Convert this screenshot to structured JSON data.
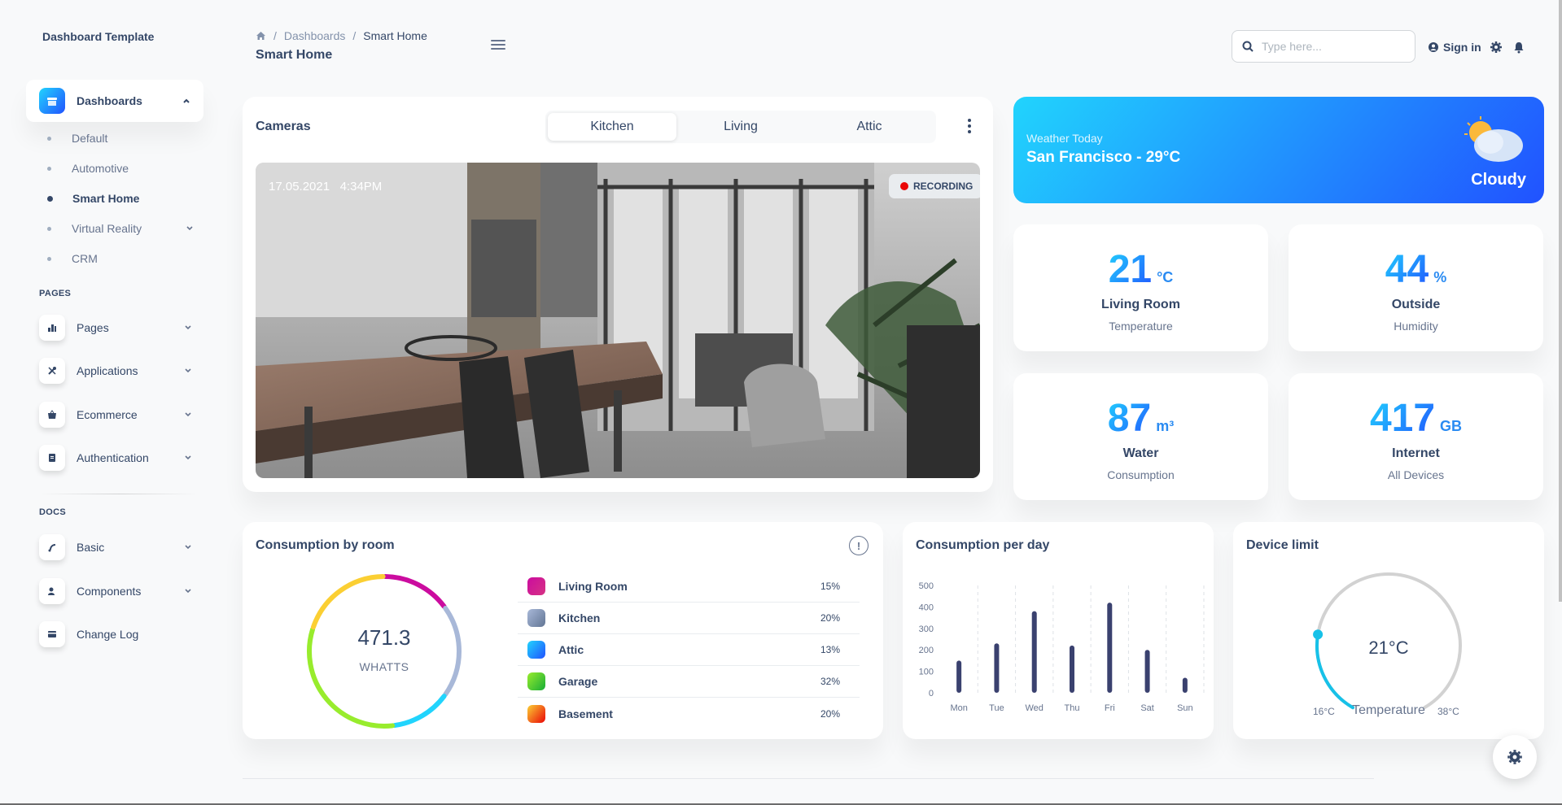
{
  "sidebar": {
    "brand": "Dashboard Template",
    "dashboards_label": "Dashboards",
    "sub_items": [
      {
        "label": "Default"
      },
      {
        "label": "Automotive"
      },
      {
        "label": "Smart Home"
      },
      {
        "label": "Virtual Reality"
      },
      {
        "label": "CRM"
      }
    ],
    "pages_section": "PAGES",
    "pages_items": [
      {
        "label": "Pages"
      },
      {
        "label": "Applications"
      },
      {
        "label": "Ecommerce"
      },
      {
        "label": "Authentication"
      }
    ],
    "docs_section": "DOCS",
    "docs_items": [
      {
        "label": "Basic"
      },
      {
        "label": "Components"
      },
      {
        "label": "Change Log"
      }
    ]
  },
  "header": {
    "breadcrumb": [
      "Dashboards",
      "Smart Home"
    ],
    "title": "Smart Home",
    "search_placeholder": "Type here...",
    "sign_in": "Sign in"
  },
  "cameras": {
    "title": "Cameras",
    "tabs": [
      "Kitchen",
      "Living",
      "Attic"
    ],
    "active_tab": "Kitchen",
    "date": "17.05.2021",
    "time": "4:34PM",
    "recording": "RECORDING"
  },
  "weather": {
    "label": "Weather Today",
    "city": "San Francisco - 29°C",
    "condition": "Cloudy"
  },
  "stats": [
    {
      "value": "21",
      "unit": "°C",
      "title": "Living Room",
      "subtitle": "Temperature"
    },
    {
      "value": "44",
      "unit": "%",
      "title": "Outside",
      "subtitle": "Humidity"
    },
    {
      "value": "87",
      "unit": "m³",
      "title": "Water",
      "subtitle": "Consumption"
    },
    {
      "value": "417",
      "unit": "GB",
      "title": "Internet",
      "subtitle": "All Devices"
    }
  ],
  "consumption_room": {
    "title": "Consumption by room",
    "total": "471.3",
    "total_unit": "WHATTS",
    "info_icon": "!",
    "rooms": [
      {
        "name": "Living Room",
        "percent": "15%",
        "color": "#cb0c9f",
        "color2": "#d63384"
      },
      {
        "name": "Kitchen",
        "percent": "20%",
        "color": "#a8b8d8",
        "color2": "#627594"
      },
      {
        "name": "Attic",
        "percent": "13%",
        "color": "#21d4fd",
        "color2": "#2152ff"
      },
      {
        "name": "Garage",
        "percent": "32%",
        "color": "#98ec2d",
        "color2": "#17ad37"
      },
      {
        "name": "Basement",
        "percent": "20%",
        "color": "#fbcf33",
        "color2": "#ea0606"
      }
    ]
  },
  "consumption_day": {
    "title": "Consumption per day"
  },
  "device_limit": {
    "title": "Device limit",
    "value": "21°C",
    "label": "Temperature",
    "min": "16°C",
    "max": "38°C",
    "fraction": 0.23
  },
  "chart_data": {
    "type": "bar",
    "categories": [
      "Mon",
      "Tue",
      "Wed",
      "Thu",
      "Fri",
      "Sat",
      "Sun"
    ],
    "values": [
      150,
      230,
      380,
      220,
      420,
      200,
      70
    ],
    "ylim": [
      0,
      500
    ],
    "yticks": [
      0,
      100,
      200,
      300,
      400,
      500
    ],
    "xlabel": "",
    "ylabel": "",
    "title": "Consumption per day"
  },
  "donut_data": {
    "type": "pie",
    "labels": [
      "Living Room",
      "Kitchen",
      "Attic",
      "Garage",
      "Basement"
    ],
    "values": [
      15,
      20,
      13,
      32,
      20
    ]
  }
}
